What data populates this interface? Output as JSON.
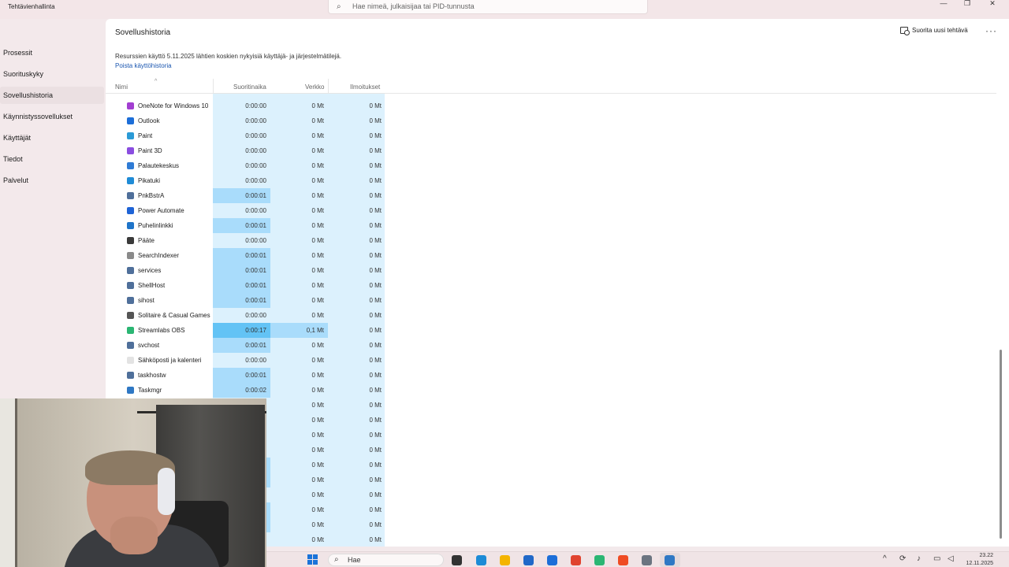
{
  "window": {
    "app_title": "Tehtävienhallinta",
    "search_placeholder": "Hae nimeä, julkaisijaa tai PID-tunnusta",
    "minimize_glyph": "—",
    "maximize_glyph": "❐",
    "close_glyph": "✕"
  },
  "sidebar": {
    "items": [
      {
        "label": "Prosessit"
      },
      {
        "label": "Suorituskyky"
      },
      {
        "label": "Sovellushistoria",
        "active": true
      },
      {
        "label": "Käynnistyssovellukset"
      },
      {
        "label": "Käyttäjät"
      },
      {
        "label": "Tiedot"
      },
      {
        "label": "Palvelut"
      }
    ]
  },
  "main": {
    "title": "Sovellushistoria",
    "run_new_task": "Suorita uusi tehtävä",
    "more_glyph": "···",
    "info_text": "Resurssien käyttö 5.11.2025 lähtien koskien nykyisiä käyttäjä- ja järjestelmätilejä.",
    "clear_history": "Poista käyttöhistoria",
    "columns": {
      "name": "Nimi",
      "cpu": "Suoritinaika",
      "network": "Verkko",
      "notifications": "Ilmoitukset"
    },
    "rows": [
      {
        "name": "OneNote for Windows 10",
        "cpu": "0:00:00",
        "network": "0 Mt",
        "notifications": "0 Mt",
        "icon_color": "#a23ed1",
        "cpu_highlight": "light",
        "net_highlight": "light"
      },
      {
        "name": "Outlook",
        "cpu": "0:00:00",
        "network": "0 Mt",
        "notifications": "0 Mt",
        "icon_color": "#1c6ed8",
        "cpu_highlight": "light",
        "net_highlight": "light"
      },
      {
        "name": "Paint",
        "cpu": "0:00:00",
        "network": "0 Mt",
        "notifications": "0 Mt",
        "icon_color": "#2a9ad6",
        "cpu_highlight": "light",
        "net_highlight": "light"
      },
      {
        "name": "Paint 3D",
        "cpu": "0:00:00",
        "network": "0 Mt",
        "notifications": "0 Mt",
        "icon_color": "#8a4de0",
        "cpu_highlight": "light",
        "net_highlight": "light"
      },
      {
        "name": "Palautekeskus",
        "cpu": "0:00:00",
        "network": "0 Mt",
        "notifications": "0 Mt",
        "icon_color": "#2f7bd5",
        "cpu_highlight": "light",
        "net_highlight": "light"
      },
      {
        "name": "Pikatuki",
        "cpu": "0:00:00",
        "network": "0 Mt",
        "notifications": "0 Mt",
        "icon_color": "#1f8bd6",
        "cpu_highlight": "light",
        "net_highlight": "light"
      },
      {
        "name": "PnkBstrA",
        "cpu": "0:00:01",
        "network": "0 Mt",
        "notifications": "0 Mt",
        "icon_color": "#4f6f9a",
        "cpu_highlight": "mid",
        "net_highlight": "light"
      },
      {
        "name": "Power Automate",
        "cpu": "0:00:00",
        "network": "0 Mt",
        "notifications": "0 Mt",
        "icon_color": "#1e63d6",
        "cpu_highlight": "light",
        "net_highlight": "light"
      },
      {
        "name": "Puhelinlinkki",
        "cpu": "0:00:01",
        "network": "0 Mt",
        "notifications": "0 Mt",
        "icon_color": "#1f74c9",
        "cpu_highlight": "mid",
        "net_highlight": "light"
      },
      {
        "name": "Pääte",
        "cpu": "0:00:00",
        "network": "0 Mt",
        "notifications": "0 Mt",
        "icon_color": "#3a3a3a",
        "cpu_highlight": "light",
        "net_highlight": "light"
      },
      {
        "name": "SearchIndexer",
        "cpu": "0:00:01",
        "network": "0 Mt",
        "notifications": "0 Mt",
        "icon_color": "#8a8a8a",
        "cpu_highlight": "mid",
        "net_highlight": "light"
      },
      {
        "name": "services",
        "cpu": "0:00:01",
        "network": "0 Mt",
        "notifications": "0 Mt",
        "icon_color": "#4f6f9a",
        "cpu_highlight": "mid",
        "net_highlight": "light"
      },
      {
        "name": "ShellHost",
        "cpu": "0:00:01",
        "network": "0 Mt",
        "notifications": "0 Mt",
        "icon_color": "#4f6f9a",
        "cpu_highlight": "mid",
        "net_highlight": "light"
      },
      {
        "name": "sihost",
        "cpu": "0:00:01",
        "network": "0 Mt",
        "notifications": "0 Mt",
        "icon_color": "#4f6f9a",
        "cpu_highlight": "mid",
        "net_highlight": "light"
      },
      {
        "name": "Solitaire & Casual Games",
        "cpu": "0:00:00",
        "network": "0 Mt",
        "notifications": "0 Mt",
        "icon_color": "#555555",
        "cpu_highlight": "light",
        "net_highlight": "light"
      },
      {
        "name": "Streamlabs OBS",
        "cpu": "0:00:17",
        "network": "0,1 Mt",
        "notifications": "0 Mt",
        "icon_color": "#2bb673",
        "cpu_highlight": "strong",
        "net_highlight": "mid"
      },
      {
        "name": "svchost",
        "cpu": "0:00:01",
        "network": "0 Mt",
        "notifications": "0 Mt",
        "icon_color": "#4f6f9a",
        "cpu_highlight": "mid",
        "net_highlight": "light"
      },
      {
        "name": "Sähköposti ja kalenteri",
        "cpu": "0:00:00",
        "network": "0 Mt",
        "notifications": "0 Mt",
        "icon_color": "#e3e3e3",
        "cpu_highlight": "light",
        "net_highlight": "light"
      },
      {
        "name": "taskhostw",
        "cpu": "0:00:01",
        "network": "0 Mt",
        "notifications": "0 Mt",
        "icon_color": "#4f6f9a",
        "cpu_highlight": "mid",
        "net_highlight": "light"
      },
      {
        "name": "Taskmgr",
        "cpu": "0:00:02",
        "network": "0 Mt",
        "notifications": "0 Mt",
        "icon_color": "#2f78c4",
        "cpu_highlight": "mid",
        "net_highlight": "light"
      },
      {
        "name": "",
        "cpu": "0",
        "network": "0 Mt",
        "notifications": "0 Mt",
        "icon_color": "",
        "cpu_highlight": "light",
        "net_highlight": "light"
      },
      {
        "name": "",
        "cpu": "0",
        "network": "0 Mt",
        "notifications": "0 Mt",
        "icon_color": "",
        "cpu_highlight": "light",
        "net_highlight": "light"
      },
      {
        "name": "",
        "cpu": "0",
        "network": "0 Mt",
        "notifications": "0 Mt",
        "icon_color": "",
        "cpu_highlight": "light",
        "net_highlight": "light"
      },
      {
        "name": "",
        "cpu": "0",
        "network": "0 Mt",
        "notifications": "0 Mt",
        "icon_color": "",
        "cpu_highlight": "light",
        "net_highlight": "light"
      },
      {
        "name": "",
        "cpu": "",
        "network": "0 Mt",
        "notifications": "0 Mt",
        "icon_color": "",
        "cpu_highlight": "mid",
        "net_highlight": "light"
      },
      {
        "name": "",
        "cpu": "",
        "network": "0 Mt",
        "notifications": "0 Mt",
        "icon_color": "",
        "cpu_highlight": "mid",
        "net_highlight": "light"
      },
      {
        "name": "",
        "cpu": "0",
        "network": "0 Mt",
        "notifications": "0 Mt",
        "icon_color": "",
        "cpu_highlight": "light",
        "net_highlight": "light"
      },
      {
        "name": "",
        "cpu": "",
        "network": "0 Mt",
        "notifications": "0 Mt",
        "icon_color": "",
        "cpu_highlight": "mid",
        "net_highlight": "light"
      },
      {
        "name": "",
        "cpu": "",
        "network": "0 Mt",
        "notifications": "0 Mt",
        "icon_color": "",
        "cpu_highlight": "mid",
        "net_highlight": "light"
      },
      {
        "name": "",
        "cpu": "0",
        "network": "0 Mt",
        "notifications": "0 Mt",
        "icon_color": "",
        "cpu_highlight": "light",
        "net_highlight": "light"
      }
    ]
  },
  "taskbar": {
    "search_label": "Hae",
    "time": "23.22",
    "date": "12.11.2025",
    "pinned": [
      {
        "name": "file-explorer-dark-icon",
        "color": "#333333"
      },
      {
        "name": "edge-icon",
        "color": "#1c8bd6"
      },
      {
        "name": "file-explorer-icon",
        "color": "#f4b400"
      },
      {
        "name": "store-icon",
        "color": "#2068c8"
      },
      {
        "name": "outlook-icon",
        "color": "#1c6ed8"
      },
      {
        "name": "chrome-icon",
        "color": "#e0432f"
      },
      {
        "name": "streamlabs-icon",
        "color": "#2bb673"
      },
      {
        "name": "brave-icon",
        "color": "#ef4b23"
      },
      {
        "name": "settings-icon",
        "color": "#6b7480"
      },
      {
        "name": "task-manager-icon",
        "color": "#2f78c4"
      }
    ]
  }
}
